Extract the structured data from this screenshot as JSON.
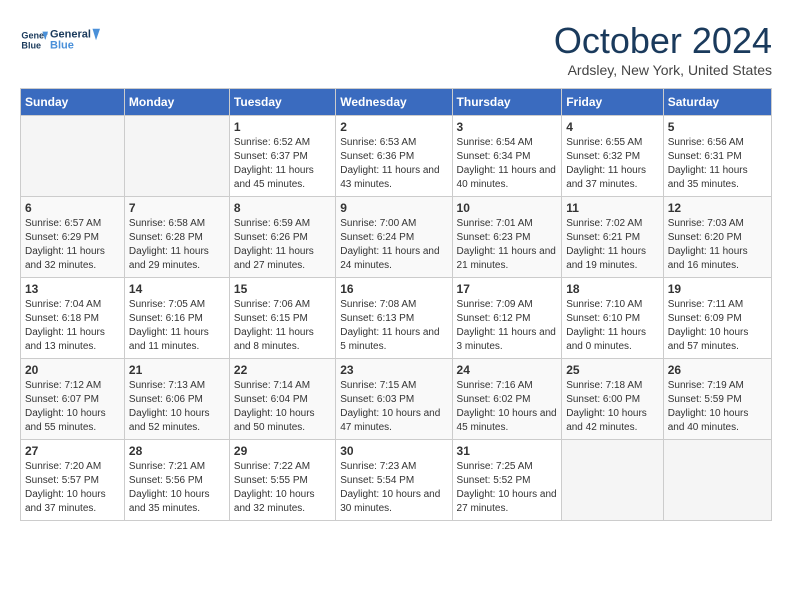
{
  "header": {
    "logo_line1": "General",
    "logo_line2": "Blue",
    "title": "October 2024",
    "location": "Ardsley, New York, United States"
  },
  "calendar": {
    "days_of_week": [
      "Sunday",
      "Monday",
      "Tuesday",
      "Wednesday",
      "Thursday",
      "Friday",
      "Saturday"
    ],
    "weeks": [
      [
        {
          "day": "",
          "info": ""
        },
        {
          "day": "",
          "info": ""
        },
        {
          "day": "1",
          "info": "Sunrise: 6:52 AM\nSunset: 6:37 PM\nDaylight: 11 hours and 45 minutes."
        },
        {
          "day": "2",
          "info": "Sunrise: 6:53 AM\nSunset: 6:36 PM\nDaylight: 11 hours and 43 minutes."
        },
        {
          "day": "3",
          "info": "Sunrise: 6:54 AM\nSunset: 6:34 PM\nDaylight: 11 hours and 40 minutes."
        },
        {
          "day": "4",
          "info": "Sunrise: 6:55 AM\nSunset: 6:32 PM\nDaylight: 11 hours and 37 minutes."
        },
        {
          "day": "5",
          "info": "Sunrise: 6:56 AM\nSunset: 6:31 PM\nDaylight: 11 hours and 35 minutes."
        }
      ],
      [
        {
          "day": "6",
          "info": "Sunrise: 6:57 AM\nSunset: 6:29 PM\nDaylight: 11 hours and 32 minutes."
        },
        {
          "day": "7",
          "info": "Sunrise: 6:58 AM\nSunset: 6:28 PM\nDaylight: 11 hours and 29 minutes."
        },
        {
          "day": "8",
          "info": "Sunrise: 6:59 AM\nSunset: 6:26 PM\nDaylight: 11 hours and 27 minutes."
        },
        {
          "day": "9",
          "info": "Sunrise: 7:00 AM\nSunset: 6:24 PM\nDaylight: 11 hours and 24 minutes."
        },
        {
          "day": "10",
          "info": "Sunrise: 7:01 AM\nSunset: 6:23 PM\nDaylight: 11 hours and 21 minutes."
        },
        {
          "day": "11",
          "info": "Sunrise: 7:02 AM\nSunset: 6:21 PM\nDaylight: 11 hours and 19 minutes."
        },
        {
          "day": "12",
          "info": "Sunrise: 7:03 AM\nSunset: 6:20 PM\nDaylight: 11 hours and 16 minutes."
        }
      ],
      [
        {
          "day": "13",
          "info": "Sunrise: 7:04 AM\nSunset: 6:18 PM\nDaylight: 11 hours and 13 minutes."
        },
        {
          "day": "14",
          "info": "Sunrise: 7:05 AM\nSunset: 6:16 PM\nDaylight: 11 hours and 11 minutes."
        },
        {
          "day": "15",
          "info": "Sunrise: 7:06 AM\nSunset: 6:15 PM\nDaylight: 11 hours and 8 minutes."
        },
        {
          "day": "16",
          "info": "Sunrise: 7:08 AM\nSunset: 6:13 PM\nDaylight: 11 hours and 5 minutes."
        },
        {
          "day": "17",
          "info": "Sunrise: 7:09 AM\nSunset: 6:12 PM\nDaylight: 11 hours and 3 minutes."
        },
        {
          "day": "18",
          "info": "Sunrise: 7:10 AM\nSunset: 6:10 PM\nDaylight: 11 hours and 0 minutes."
        },
        {
          "day": "19",
          "info": "Sunrise: 7:11 AM\nSunset: 6:09 PM\nDaylight: 10 hours and 57 minutes."
        }
      ],
      [
        {
          "day": "20",
          "info": "Sunrise: 7:12 AM\nSunset: 6:07 PM\nDaylight: 10 hours and 55 minutes."
        },
        {
          "day": "21",
          "info": "Sunrise: 7:13 AM\nSunset: 6:06 PM\nDaylight: 10 hours and 52 minutes."
        },
        {
          "day": "22",
          "info": "Sunrise: 7:14 AM\nSunset: 6:04 PM\nDaylight: 10 hours and 50 minutes."
        },
        {
          "day": "23",
          "info": "Sunrise: 7:15 AM\nSunset: 6:03 PM\nDaylight: 10 hours and 47 minutes."
        },
        {
          "day": "24",
          "info": "Sunrise: 7:16 AM\nSunset: 6:02 PM\nDaylight: 10 hours and 45 minutes."
        },
        {
          "day": "25",
          "info": "Sunrise: 7:18 AM\nSunset: 6:00 PM\nDaylight: 10 hours and 42 minutes."
        },
        {
          "day": "26",
          "info": "Sunrise: 7:19 AM\nSunset: 5:59 PM\nDaylight: 10 hours and 40 minutes."
        }
      ],
      [
        {
          "day": "27",
          "info": "Sunrise: 7:20 AM\nSunset: 5:57 PM\nDaylight: 10 hours and 37 minutes."
        },
        {
          "day": "28",
          "info": "Sunrise: 7:21 AM\nSunset: 5:56 PM\nDaylight: 10 hours and 35 minutes."
        },
        {
          "day": "29",
          "info": "Sunrise: 7:22 AM\nSunset: 5:55 PM\nDaylight: 10 hours and 32 minutes."
        },
        {
          "day": "30",
          "info": "Sunrise: 7:23 AM\nSunset: 5:54 PM\nDaylight: 10 hours and 30 minutes."
        },
        {
          "day": "31",
          "info": "Sunrise: 7:25 AM\nSunset: 5:52 PM\nDaylight: 10 hours and 27 minutes."
        },
        {
          "day": "",
          "info": ""
        },
        {
          "day": "",
          "info": ""
        }
      ]
    ]
  }
}
